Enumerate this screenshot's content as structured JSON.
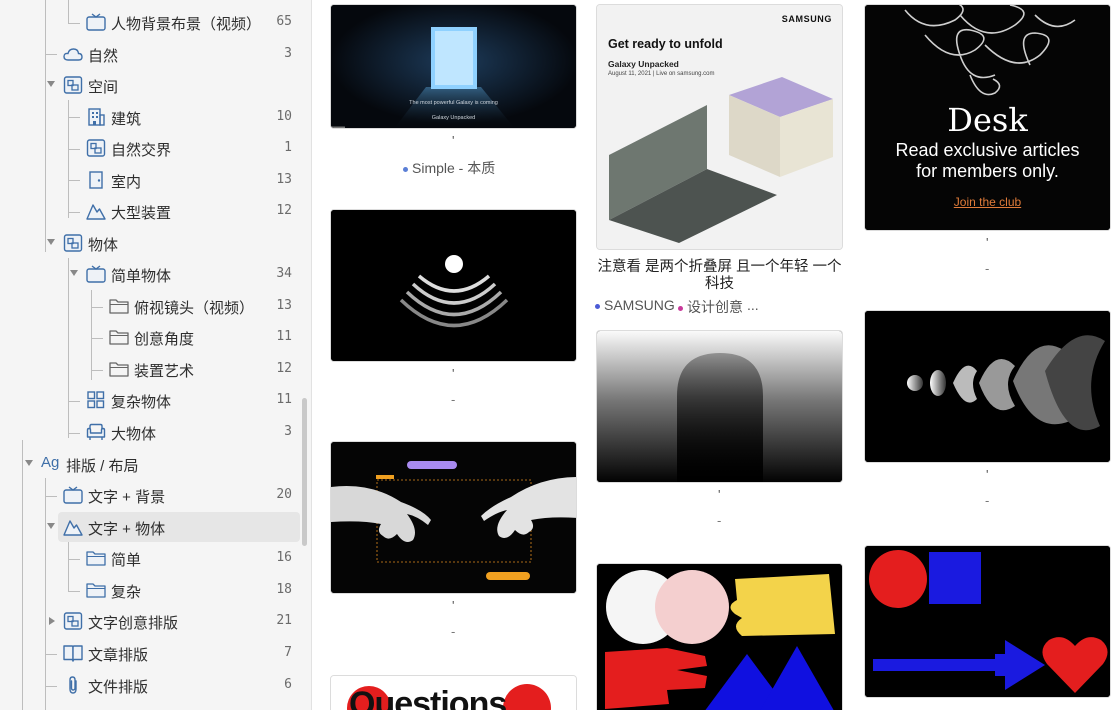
{
  "sidebar": {
    "items": [
      {
        "label": "人物背景布景（视频）",
        "count": "65",
        "icon": "tv-icon"
      },
      {
        "label": "自然",
        "count": "3",
        "icon": "cloud-icon"
      },
      {
        "label": "空间",
        "count": "",
        "icon": "space-icon"
      },
      {
        "label": "建筑",
        "count": "10",
        "icon": "building-icon"
      },
      {
        "label": "自然交界",
        "count": "1",
        "icon": "space-icon"
      },
      {
        "label": "室内",
        "count": "13",
        "icon": "door-icon"
      },
      {
        "label": "大型装置",
        "count": "12",
        "icon": "mountain-icon"
      },
      {
        "label": "物体",
        "count": "",
        "icon": "space-icon"
      },
      {
        "label": "简单物体",
        "count": "34",
        "icon": "tv-icon"
      },
      {
        "label": "俯视镜头（视频）",
        "count": "13",
        "icon": "folder-icon"
      },
      {
        "label": "创意角度",
        "count": "11",
        "icon": "folder-icon"
      },
      {
        "label": "装置艺术",
        "count": "12",
        "icon": "folder-icon"
      },
      {
        "label": "复杂物体",
        "count": "11",
        "icon": "grid-icon"
      },
      {
        "label": "大物体",
        "count": "3",
        "icon": "sofa-icon"
      },
      {
        "label": "排版 / 布局",
        "count": "",
        "icon": "ag-icon",
        "icon_text": "Ag"
      },
      {
        "label": "文字 + 背景",
        "count": "20",
        "icon": "tv-icon"
      },
      {
        "label": "文字 + 物体",
        "count": "",
        "icon": "mountain-icon"
      },
      {
        "label": "简单",
        "count": "16",
        "icon": "folder-icon"
      },
      {
        "label": "复杂",
        "count": "18",
        "icon": "folder-icon"
      },
      {
        "label": "文字创意排版",
        "count": "21",
        "icon": "space-icon"
      },
      {
        "label": "文章排版",
        "count": "7",
        "icon": "book-icon"
      },
      {
        "label": "文件排版",
        "count": "6",
        "icon": "clip-icon"
      }
    ]
  },
  "gallery": {
    "col1": {
      "card1": {
        "text1": "The most powerful Galaxy is coming",
        "text2": "Galaxy Unpacked",
        "tag": "Simple - 本质",
        "tag_color": "#5b7fd6"
      },
      "card2": {
        "caption_tick": "'",
        "caption_dash": "-"
      },
      "card3": {
        "caption_tick": "'",
        "caption_dash": "-"
      },
      "card4": {
        "text": "Questions"
      }
    },
    "col2": {
      "card1": {
        "brand": "SAMSUNG",
        "headline": "Get ready to unfold",
        "sub": "Galaxy Unpacked",
        "date": "August 11, 2021 | Live on samsung.com",
        "title": "注意看 是两个折叠屏 且一个年轻 一个科技",
        "tags": [
          {
            "label": "SAMSUNG",
            "color": "#4b5bd6"
          },
          {
            "label": "设计创意",
            "color": "#c8399a"
          }
        ],
        "more": "..."
      },
      "card2": {
        "caption_tick": "'",
        "caption_dash": "-"
      }
    },
    "col3": {
      "card1": {
        "logo": "Desk",
        "line1": "Read exclusive articles",
        "line2": "for members only.",
        "link": "Join the club",
        "caption_tick": "'",
        "caption_dash": "-"
      },
      "card2": {
        "caption_tick": "'",
        "caption_dash": "-"
      }
    },
    "col1_caption": {
      "tick": "'",
      "dash": "-"
    }
  },
  "colors": {
    "icon_blue": "#3f6fa8",
    "orange": "#e07b39",
    "selected_row": "#e6e6e6"
  }
}
